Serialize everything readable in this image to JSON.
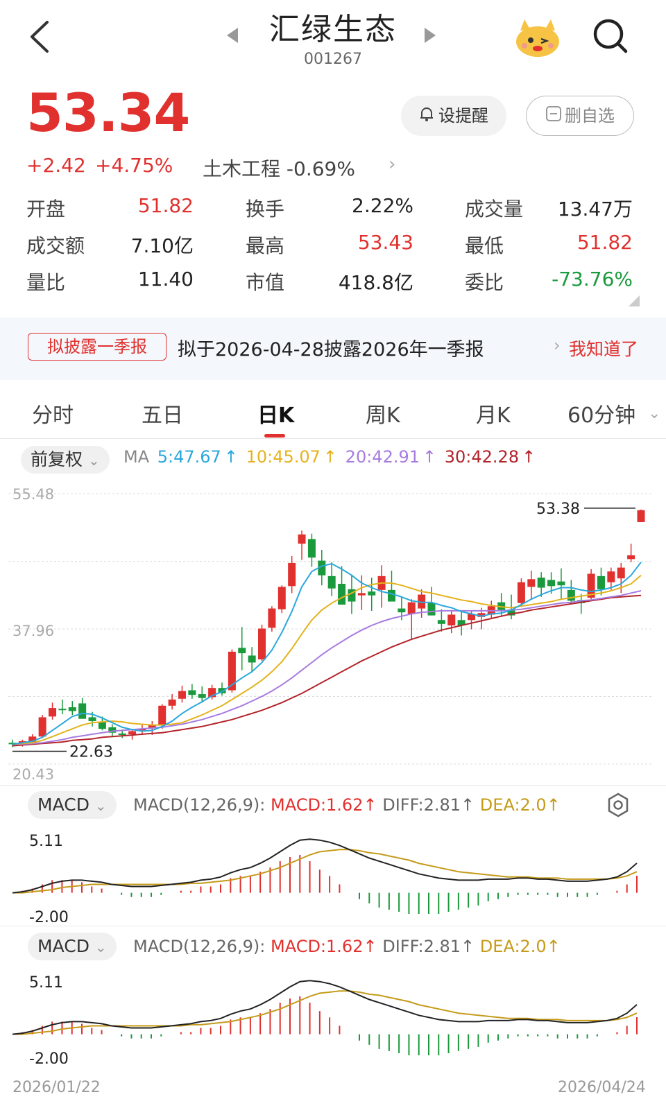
{
  "header": {
    "title": "汇绿生态",
    "code": "001267"
  },
  "quote": {
    "price": "53.34",
    "change": "+2.42",
    "change_pct": "+4.75%",
    "sector": "土木工程 -0.69%",
    "alert_label": "设提醒",
    "remove_watch_label": "删自选"
  },
  "stats": [
    {
      "label": "开盘",
      "value": "51.82",
      "color": "red"
    },
    {
      "label": "换手",
      "value": "2.22%",
      "color": "black"
    },
    {
      "label": "成交量",
      "value": "13.47万",
      "color": "black"
    },
    {
      "label": "成交额",
      "value": "7.10亿",
      "color": "black"
    },
    {
      "label": "最高",
      "value": "53.43",
      "color": "red"
    },
    {
      "label": "最低",
      "value": "51.82",
      "color": "red"
    },
    {
      "label": "量比",
      "value": "11.40",
      "color": "black"
    },
    {
      "label": "市值",
      "value": "418.8亿",
      "color": "black"
    },
    {
      "label": "委比",
      "value": "-73.76%",
      "color": "green"
    }
  ],
  "notice": {
    "tag": "拟披露一季报",
    "text": "拟于2026-04-28披露2026年一季报",
    "action": "我知道了"
  },
  "tabs": [
    "分时",
    "五日",
    "日K",
    "周K",
    "月K",
    "60分钟"
  ],
  "active_tab": "日K",
  "ma": {
    "adjust_label": "前复权",
    "prefix": "MA",
    "ma5": "5:47.67",
    "ma10": "10:45.07",
    "ma20": "20:42.91",
    "ma30": "30:42.28",
    "colors": {
      "ma5": "#2aa7dc",
      "ma10": "#e4b21c",
      "ma20": "#a77be0",
      "ma30": "#b3242a"
    }
  },
  "kline": {
    "y_top_label": "55.48",
    "y_mid_label": "37.96",
    "y_bottom_label": "20.43",
    "high_marker": "53.38",
    "low_marker": "22.63"
  },
  "macd_panels": [
    {
      "selector": "MACD",
      "params": "MACD(12,26,9):",
      "macd": "MACD:1.62",
      "diff": "DIFF:2.81",
      "dea": "DEA:2.0",
      "y_top": "5.11",
      "y_bottom": "-2.00"
    },
    {
      "selector": "MACD",
      "params": "MACD(12,26,9):",
      "macd": "MACD:1.62",
      "diff": "DIFF:2.81",
      "dea": "DEA:2.0",
      "y_top": "5.11",
      "y_bottom": "-2.00"
    }
  ],
  "footer": {
    "date_start": "2026/01/22",
    "date_end": "2026/04/24"
  },
  "chart_data": {
    "type": "candlestick",
    "ylim": [
      20.43,
      55.48
    ],
    "candles": [
      [
        23.2,
        23.6,
        22.63,
        23.0
      ],
      [
        23.0,
        23.6,
        22.7,
        23.4
      ],
      [
        23.3,
        24.3,
        23.1,
        24.0
      ],
      [
        24.0,
        26.8,
        23.9,
        26.5
      ],
      [
        26.6,
        28.4,
        26.2,
        27.7
      ],
      [
        27.6,
        28.8,
        26.9,
        27.5
      ],
      [
        27.8,
        28.6,
        26.8,
        27.3
      ],
      [
        28.3,
        29.0,
        26.9,
        26.3
      ],
      [
        26.5,
        27.2,
        25.3,
        26.0
      ],
      [
        25.9,
        26.6,
        24.8,
        25.0
      ],
      [
        25.2,
        25.6,
        23.9,
        24.5
      ],
      [
        24.4,
        24.9,
        23.8,
        24.2
      ],
      [
        24.3,
        25.0,
        23.6,
        24.7
      ],
      [
        24.8,
        25.6,
        24.2,
        25.0
      ],
      [
        25.1,
        26.0,
        24.2,
        25.5
      ],
      [
        25.5,
        28.2,
        25.0,
        28.0
      ],
      [
        28.0,
        29.5,
        27.5,
        28.8
      ],
      [
        28.9,
        30.6,
        28.4,
        29.9
      ],
      [
        30.0,
        30.8,
        28.9,
        29.4
      ],
      [
        29.5,
        30.5,
        28.4,
        29.0
      ],
      [
        29.1,
        30.7,
        28.8,
        30.3
      ],
      [
        30.3,
        31.0,
        29.3,
        29.6
      ],
      [
        30.0,
        35.3,
        29.7,
        35.0
      ],
      [
        35.5,
        38.2,
        32.6,
        34.8
      ],
      [
        34.5,
        35.6,
        32.3,
        33.6
      ],
      [
        34.0,
        38.5,
        33.8,
        38.0
      ],
      [
        38.1,
        40.9,
        37.6,
        40.6
      ],
      [
        40.5,
        43.6,
        40.0,
        43.4
      ],
      [
        43.5,
        47.4,
        42.6,
        46.5
      ],
      [
        49.0,
        50.7,
        46.9,
        50.2
      ],
      [
        49.6,
        50.3,
        46.0,
        47.2
      ],
      [
        46.8,
        48.2,
        43.6,
        44.9
      ],
      [
        44.8,
        46.6,
        42.2,
        43.2
      ],
      [
        43.8,
        46.1,
        42.2,
        41.1
      ],
      [
        43.1,
        45.0,
        39.9,
        41.5
      ],
      [
        42.3,
        44.9,
        40.4,
        42.6
      ],
      [
        42.8,
        44.6,
        40.3,
        42.3
      ],
      [
        43.0,
        46.2,
        40.7,
        44.8
      ],
      [
        43.0,
        45.5,
        41.8,
        41.5
      ],
      [
        40.6,
        42.1,
        39.1,
        40.1
      ],
      [
        39.9,
        41.8,
        36.6,
        41.4
      ],
      [
        40.6,
        43.1,
        39.4,
        42.4
      ],
      [
        41.3,
        43.4,
        39.7,
        39.7
      ],
      [
        39.1,
        40.5,
        37.6,
        38.6
      ],
      [
        38.4,
        40.3,
        37.4,
        39.8
      ],
      [
        39.1,
        40.3,
        37.1,
        38.4
      ],
      [
        39.1,
        40.3,
        37.9,
        39.9
      ],
      [
        39.5,
        40.7,
        37.9,
        40.0
      ],
      [
        39.8,
        41.6,
        39.3,
        40.9
      ],
      [
        41.4,
        42.6,
        39.5,
        40.4
      ],
      [
        40.4,
        42.4,
        39.2,
        39.7
      ],
      [
        41.3,
        44.5,
        40.8,
        44.0
      ],
      [
        43.4,
        45.5,
        41.9,
        44.4
      ],
      [
        44.6,
        45.3,
        42.1,
        43.3
      ],
      [
        44.3,
        45.3,
        42.5,
        43.5
      ],
      [
        44.1,
        45.8,
        41.8,
        43.6
      ],
      [
        43.0,
        44.3,
        41.1,
        41.6
      ],
      [
        41.7,
        42.5,
        39.9,
        41.3
      ],
      [
        42.0,
        45.7,
        41.8,
        45.1
      ],
      [
        44.8,
        45.9,
        42.3,
        43.1
      ],
      [
        44.0,
        45.9,
        43.0,
        45.4
      ],
      [
        44.5,
        46.5,
        42.6,
        45.9
      ],
      [
        47.0,
        49.0,
        46.6,
        47.5
      ],
      [
        51.8,
        53.43,
        51.8,
        53.34
      ]
    ],
    "ma5": [
      23.0,
      23.2,
      23.4,
      23.9,
      24.8,
      25.7,
      26.6,
      27.0,
      26.9,
      26.4,
      25.8,
      25.2,
      24.9,
      24.7,
      24.8,
      25.3,
      26.0,
      27.0,
      27.8,
      28.5,
      29.3,
      29.8,
      30.7,
      31.6,
      32.4,
      33.6,
      35.2,
      37.5,
      40.2,
      43.4,
      45.4,
      46.1,
      46.4,
      45.7,
      44.9,
      43.9,
      43.3,
      42.8,
      42.5,
      42.1,
      41.6,
      41.4,
      41.4,
      41.0,
      40.7,
      40.2,
      39.9,
      39.6,
      39.9,
      40.0,
      40.4,
      41.1,
      41.8,
      42.4,
      42.9,
      43.3,
      43.3,
      43.0,
      42.8,
      43.0,
      43.3,
      43.8,
      44.9,
      46.6
    ],
    "ma10": [
      23.0,
      23.1,
      23.2,
      23.5,
      24.0,
      24.5,
      25.0,
      25.5,
      25.8,
      25.9,
      26.0,
      25.9,
      25.7,
      25.6,
      25.5,
      25.5,
      25.6,
      25.8,
      26.3,
      26.8,
      27.4,
      28.0,
      28.8,
      29.6,
      30.4,
      31.3,
      32.4,
      33.7,
      35.4,
      37.3,
      39.1,
      40.4,
      41.3,
      42.0,
      42.6,
      43.3,
      43.7,
      43.9,
      43.9,
      43.6,
      43.2,
      42.8,
      42.6,
      42.3,
      42.0,
      41.7,
      41.5,
      41.2,
      41.0,
      40.8,
      40.7,
      40.9,
      41.1,
      41.3,
      41.5,
      41.8,
      42.0,
      42.2,
      42.4,
      42.6,
      42.9,
      43.3,
      43.8,
      44.9
    ],
    "ma20": [
      23.0,
      23.0,
      23.1,
      23.2,
      23.4,
      23.6,
      23.9,
      24.1,
      24.3,
      24.5,
      24.7,
      24.8,
      24.9,
      25.0,
      25.1,
      25.2,
      25.4,
      25.6,
      25.9,
      26.2,
      26.6,
      27.0,
      27.5,
      28.0,
      28.6,
      29.2,
      29.9,
      30.7,
      31.6,
      32.6,
      33.6,
      34.6,
      35.5,
      36.3,
      37.1,
      37.8,
      38.4,
      38.9,
      39.3,
      39.6,
      39.9,
      40.1,
      40.2,
      40.3,
      40.3,
      40.3,
      40.3,
      40.3,
      40.3,
      40.3,
      40.4,
      40.5,
      40.7,
      40.9,
      41.1,
      41.3,
      41.4,
      41.6,
      41.7,
      41.9,
      42.1,
      42.3,
      42.6,
      42.9
    ],
    "ma30": [
      22.8,
      22.9,
      23.0,
      23.1,
      23.2,
      23.3,
      23.5,
      23.6,
      23.7,
      23.9,
      24.0,
      24.1,
      24.2,
      24.3,
      24.4,
      24.5,
      24.7,
      24.9,
      25.1,
      25.3,
      25.6,
      25.9,
      26.2,
      26.6,
      27.0,
      27.4,
      27.9,
      28.4,
      29.0,
      29.6,
      30.3,
      31.0,
      31.7,
      32.4,
      33.1,
      33.8,
      34.4,
      35.0,
      35.6,
      36.1,
      36.6,
      37.0,
      37.4,
      37.8,
      38.1,
      38.4,
      38.7,
      39.0,
      39.3,
      39.6,
      39.9,
      40.1,
      40.4,
      40.6,
      40.8,
      41.0,
      41.2,
      41.4,
      41.6,
      41.8,
      42.0,
      42.1,
      42.2,
      42.3
    ],
    "macd": {
      "ylim": [
        -2.0,
        5.11
      ],
      "diff": [
        0.0,
        0.1,
        0.3,
        0.6,
        0.9,
        1.1,
        1.2,
        1.2,
        1.1,
        1.0,
        0.8,
        0.7,
        0.6,
        0.6,
        0.6,
        0.7,
        0.8,
        0.9,
        1.0,
        1.2,
        1.3,
        1.5,
        1.9,
        2.2,
        2.4,
        2.8,
        3.3,
        3.9,
        4.5,
        5.0,
        5.1,
        5.0,
        4.8,
        4.5,
        4.1,
        3.7,
        3.3,
        3.0,
        2.7,
        2.4,
        2.1,
        1.8,
        1.6,
        1.4,
        1.3,
        1.2,
        1.2,
        1.2,
        1.3,
        1.3,
        1.3,
        1.4,
        1.4,
        1.3,
        1.3,
        1.2,
        1.1,
        1.1,
        1.1,
        1.2,
        1.3,
        1.5,
        2.0,
        2.81
      ],
      "dea": [
        0.0,
        0.0,
        0.1,
        0.2,
        0.3,
        0.5,
        0.6,
        0.7,
        0.8,
        0.8,
        0.8,
        0.8,
        0.8,
        0.8,
        0.8,
        0.8,
        0.8,
        0.8,
        0.9,
        0.9,
        1.0,
        1.1,
        1.2,
        1.4,
        1.6,
        1.8,
        2.1,
        2.4,
        2.8,
        3.2,
        3.6,
        3.9,
        4.0,
        4.1,
        4.1,
        4.0,
        3.8,
        3.7,
        3.5,
        3.3,
        3.1,
        2.8,
        2.6,
        2.4,
        2.2,
        2.0,
        1.9,
        1.8,
        1.7,
        1.6,
        1.5,
        1.5,
        1.5,
        1.4,
        1.4,
        1.4,
        1.3,
        1.3,
        1.3,
        1.3,
        1.3,
        1.4,
        1.6,
        2.0
      ],
      "hist": [
        0.0,
        0.2,
        0.4,
        0.8,
        1.2,
        1.2,
        1.2,
        1.0,
        0.6,
        0.4,
        0.0,
        -0.2,
        -0.4,
        -0.4,
        -0.4,
        -0.2,
        0.0,
        0.2,
        0.2,
        0.6,
        0.6,
        0.8,
        1.4,
        1.6,
        1.6,
        2.0,
        2.4,
        3.0,
        3.4,
        3.6,
        3.0,
        2.2,
        1.6,
        0.8,
        0.0,
        -0.6,
        -1.0,
        -1.4,
        -1.6,
        -1.8,
        -2.0,
        -2.0,
        -2.0,
        -2.0,
        -1.8,
        -1.6,
        -1.4,
        -1.2,
        -0.8,
        -0.6,
        -0.4,
        -0.2,
        -0.2,
        -0.2,
        -0.2,
        -0.4,
        -0.4,
        -0.4,
        -0.4,
        -0.2,
        0.0,
        0.2,
        0.8,
        1.62
      ]
    }
  }
}
